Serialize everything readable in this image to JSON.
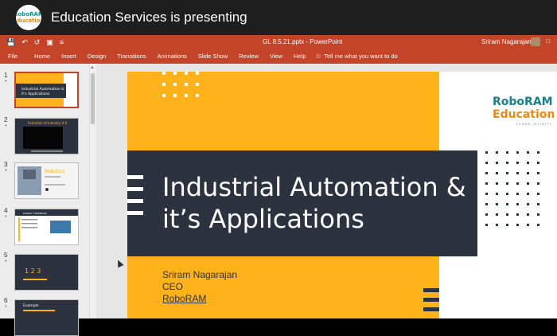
{
  "meeting": {
    "title": "Education Services is presenting",
    "logo_line1": "RoboRAM",
    "logo_line2": "Education"
  },
  "titlebar": {
    "document_title": "GL  8.5.21.pptx  -  PowerPoint",
    "user_name": "Sriram Nagarajan",
    "qat_icons": [
      "save-icon",
      "undo-icon",
      "redo-icon",
      "present-icon",
      "customize-icon"
    ],
    "colors": {
      "accent": "#c4442a"
    }
  },
  "ribbon": {
    "tabs": [
      "File",
      "Home",
      "Insert",
      "Design",
      "Transitions",
      "Animations",
      "Slide Show",
      "Review",
      "View",
      "Help"
    ],
    "tell_me": "Tell me what you want to do"
  },
  "thumbnails": [
    {
      "number": "1",
      "star": "*",
      "title": "Industrial Automation & it's Applications",
      "active": true
    },
    {
      "number": "2",
      "star": "*",
      "title": "Evolution of Industry 4.0",
      "active": false
    },
    {
      "number": "3",
      "star": "*",
      "title": "Robotics",
      "active": false
    },
    {
      "number": "4",
      "star": "*",
      "title": "Levels Constants",
      "active": false
    },
    {
      "number": "5",
      "star": "*",
      "title": "1 2 3",
      "active": false
    },
    {
      "number": "6",
      "star": "*",
      "title": "Example",
      "active": false
    }
  ],
  "slide": {
    "title_line1": "Industrial Automation &",
    "title_line2": "it’s Applications",
    "presenter": "Sriram Nagarajan",
    "role": "CEO",
    "company": "RoboRAM",
    "logo_line1": "RoboRAM",
    "logo_line2": "Education",
    "logo_tagline": "LEARN INFINITY",
    "colors": {
      "yellow": "#ffb21a",
      "dark": "#2d323f"
    }
  }
}
